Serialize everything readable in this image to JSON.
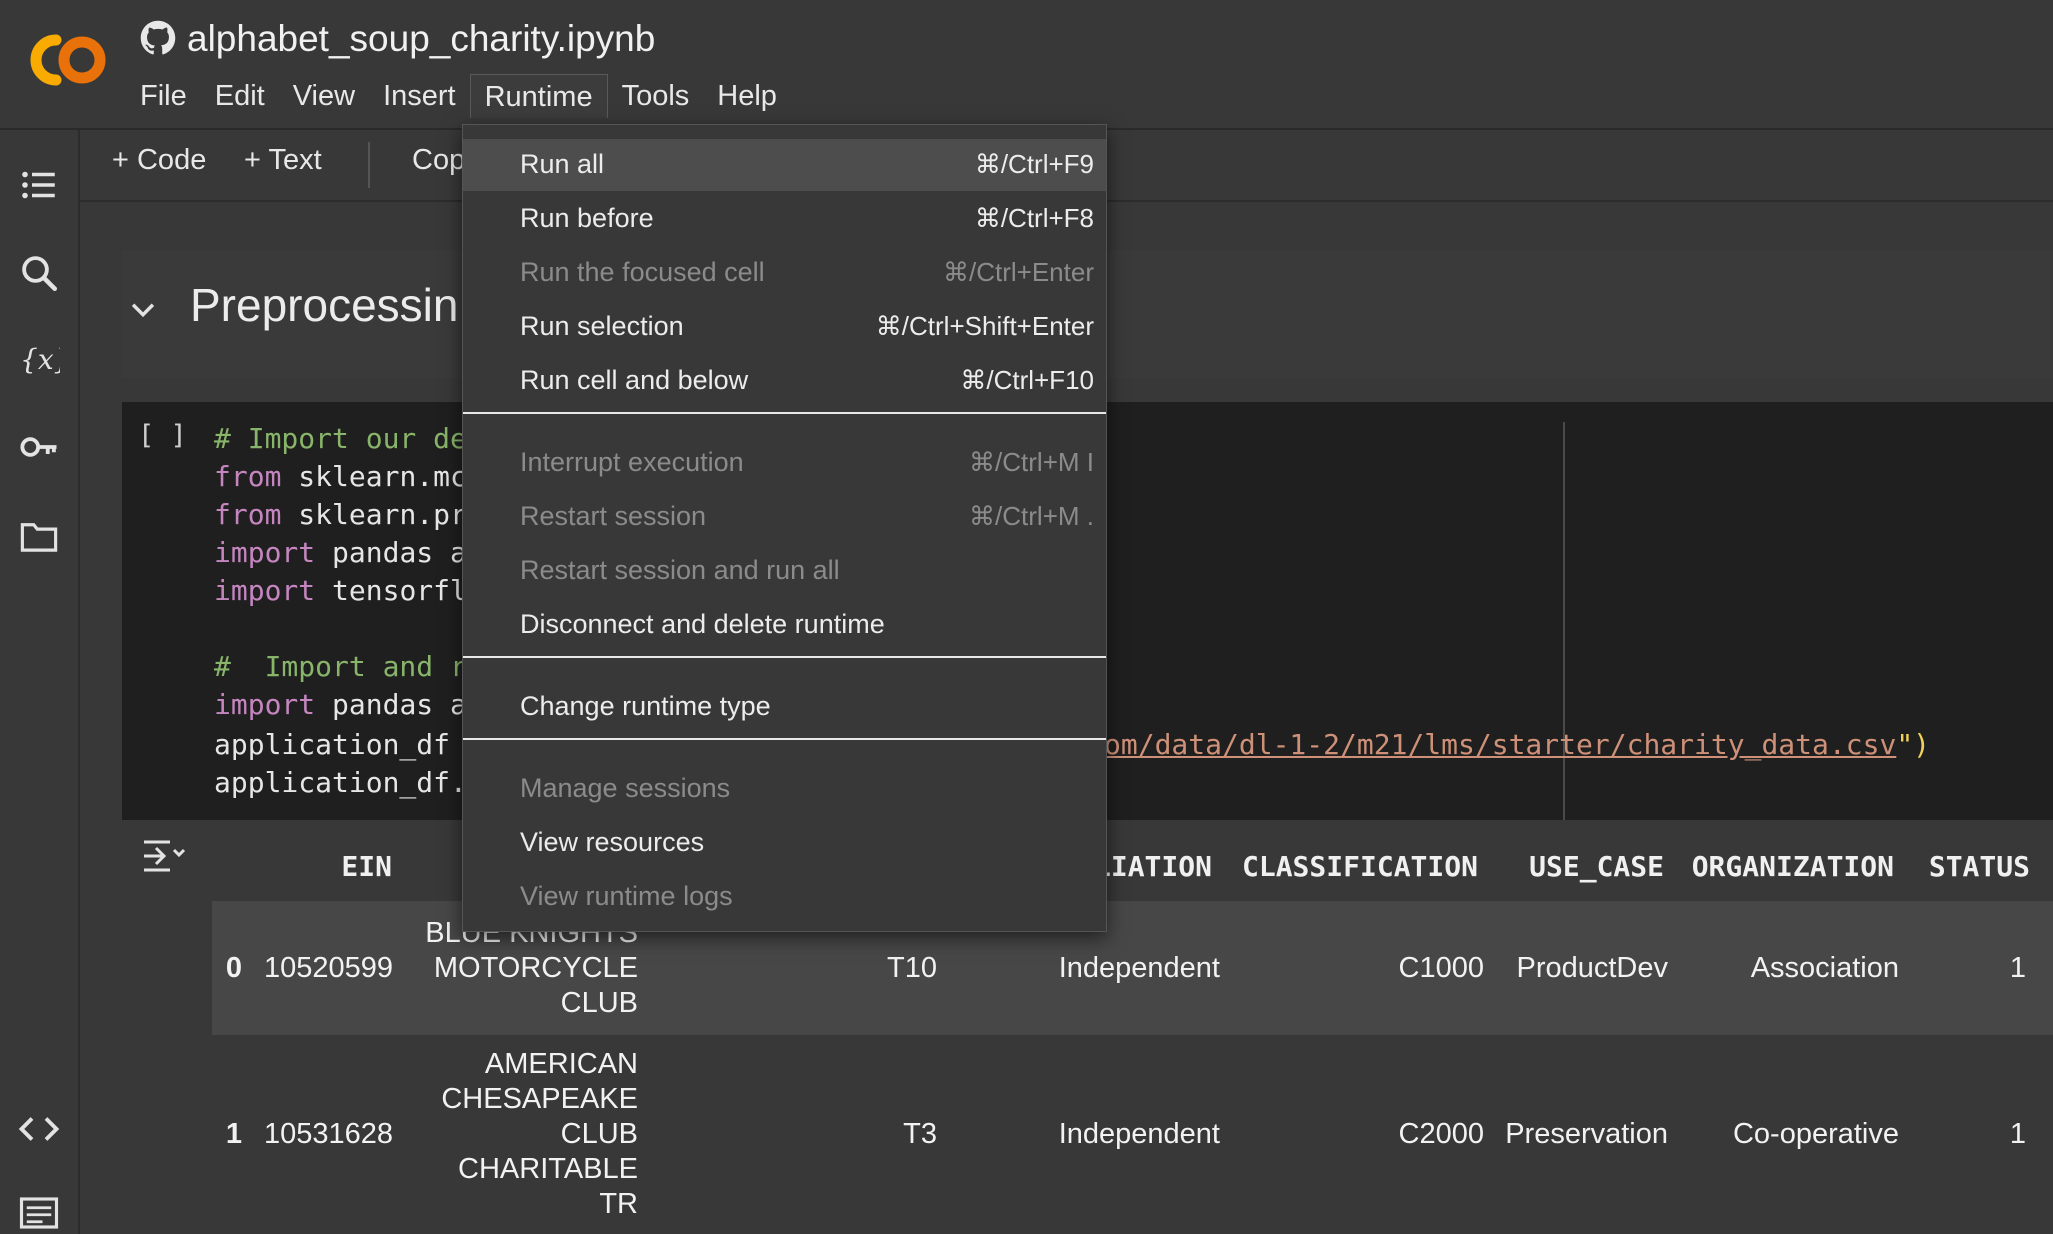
{
  "app": {
    "notebook_title": "alphabet_soup_charity.ipynb",
    "menus": [
      "File",
      "Edit",
      "View",
      "Insert",
      "Runtime",
      "Tools",
      "Help"
    ],
    "open_menu": "Runtime"
  },
  "toolbar": {
    "code_label": "+ Code",
    "text_label": "+ Text",
    "copy_label": "Cop"
  },
  "sidebar_icons": [
    "table-of-contents-icon",
    "search-icon",
    "variables-icon",
    "secrets-key-icon",
    "files-folder-icon",
    "code-snippets-icon",
    "terminal-icon"
  ],
  "text_cell": {
    "heading": "Preprocessin"
  },
  "code_cell": {
    "run_indicator": "[ ]",
    "lines": [
      [
        {
          "t": "# Import our de",
          "c": "cm"
        }
      ],
      [
        {
          "t": "from",
          "c": "kw"
        },
        {
          "t": " sklearn.mc",
          "c": ""
        }
      ],
      [
        {
          "t": "from",
          "c": "kw"
        },
        {
          "t": " sklearn.pr",
          "c": ""
        }
      ],
      [
        {
          "t": "import",
          "c": "kw"
        },
        {
          "t": " pandas a",
          "c": ""
        }
      ],
      [
        {
          "t": "import",
          "c": "kw"
        },
        {
          "t": " tensorfl",
          "c": ""
        }
      ],
      [
        {
          "t": "",
          "c": ""
        }
      ],
      [
        {
          "t": "#  Import and r",
          "c": "cm"
        }
      ],
      [
        {
          "t": "import",
          "c": "kw"
        },
        {
          "t": " pandas a",
          "c": ""
        }
      ],
      [
        {
          "t": "application_df ",
          "c": ""
        }
      ],
      [
        {
          "t": "application_df.",
          "c": ""
        }
      ]
    ],
    "url_tail": "om/data/dl-1-2/m21/lms/starter/charity_data.csv",
    "url_close": "\")"
  },
  "output": {
    "headers": [
      "EIN",
      "LIATION",
      "CLASSIFICATION",
      "USE_CASE",
      "ORGANIZATION",
      "STATUS"
    ],
    "rows": [
      {
        "index": "0",
        "ein": "10520599",
        "name": "BLUE KNIGHTS\nMOTORCYCLE\nCLUB",
        "app_type": "T10",
        "affiliation": "Independent",
        "classification": "C1000",
        "use_case": "ProductDev",
        "organization": "Association",
        "status": "1"
      },
      {
        "index": "1",
        "ein": "10531628",
        "name": "AMERICAN\nCHESAPEAKE\nCLUB\nCHARITABLE\nTR",
        "app_type": "T3",
        "affiliation": "Independent",
        "classification": "C2000",
        "use_case": "Preservation",
        "organization": "Co-operative",
        "status": "1"
      }
    ]
  },
  "runtime_menu": {
    "items": [
      {
        "label": "Run all",
        "shortcut": "⌘/Ctrl+F9",
        "enabled": true,
        "highlighted": true
      },
      {
        "label": "Run before",
        "shortcut": "⌘/Ctrl+F8",
        "enabled": true
      },
      {
        "label": "Run the focused cell",
        "shortcut": "⌘/Ctrl+Enter",
        "enabled": false
      },
      {
        "label": "Run selection",
        "shortcut": "⌘/Ctrl+Shift+Enter",
        "enabled": true
      },
      {
        "label": "Run cell and below",
        "shortcut": "⌘/Ctrl+F10",
        "enabled": true
      },
      {
        "divider": true
      },
      {
        "label": "Interrupt execution",
        "shortcut": "⌘/Ctrl+M I",
        "enabled": false
      },
      {
        "label": "Restart session",
        "shortcut": "⌘/Ctrl+M .",
        "enabled": false
      },
      {
        "label": "Restart session and run all",
        "shortcut": "",
        "enabled": false
      },
      {
        "label": "Disconnect and delete runtime",
        "shortcut": "",
        "enabled": true
      },
      {
        "divider": true
      },
      {
        "label": "Change runtime type",
        "shortcut": "",
        "enabled": true
      },
      {
        "divider": true
      },
      {
        "label": "Manage sessions",
        "shortcut": "",
        "enabled": false
      },
      {
        "label": "View resources",
        "shortcut": "",
        "enabled": true
      },
      {
        "label": "View runtime logs",
        "shortcut": "",
        "enabled": false
      }
    ]
  },
  "colors": {
    "background": "#383838",
    "code_background": "#1f1f1f",
    "comment": "#88b56a",
    "keyword": "#c586c0",
    "string": "#ce9178",
    "logo_orange": "#f9ab00"
  }
}
